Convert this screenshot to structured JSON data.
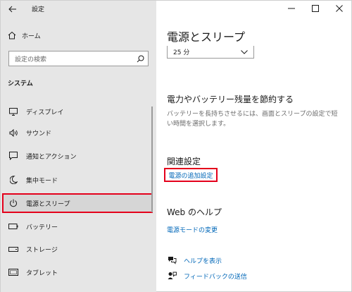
{
  "window": {
    "title": "設定",
    "controls": [
      "minimize-icon",
      "maximize-icon",
      "close-icon"
    ]
  },
  "sidebar": {
    "home_label": "ホーム",
    "search_placeholder": "設定の検索",
    "section_title": "システム",
    "items": [
      {
        "label": "ディスプレイ",
        "icon": "display-icon"
      },
      {
        "label": "サウンド",
        "icon": "sound-icon"
      },
      {
        "label": "通知とアクション",
        "icon": "notification-icon"
      },
      {
        "label": "集中モード",
        "icon": "moon-icon"
      },
      {
        "label": "電源とスリープ",
        "icon": "power-icon",
        "selected": true
      },
      {
        "label": "バッテリー",
        "icon": "battery-icon"
      },
      {
        "label": "ストレージ",
        "icon": "storage-icon"
      },
      {
        "label": "タブレット",
        "icon": "tablet-icon"
      }
    ]
  },
  "main": {
    "title": "電源とスリープ",
    "dropdown_value": "25 分",
    "save_heading": "電力やバッテリー残量を節約する",
    "save_desc": "バッテリーを長持ちさせるには、画面とスリープの設定で短い時間を選択します。",
    "related_heading": "関連設定",
    "related_link": "電源の追加設定",
    "web_help_heading": "Web のヘルプ",
    "web_help_link": "電源モードの変更",
    "help_link": "ヘルプを表示",
    "feedback_link": "フィードバックの送信"
  },
  "colors": {
    "accent_link": "#0067b8",
    "highlight_border": "#e4001b",
    "sidebar_bg": "#e6e6e6"
  }
}
